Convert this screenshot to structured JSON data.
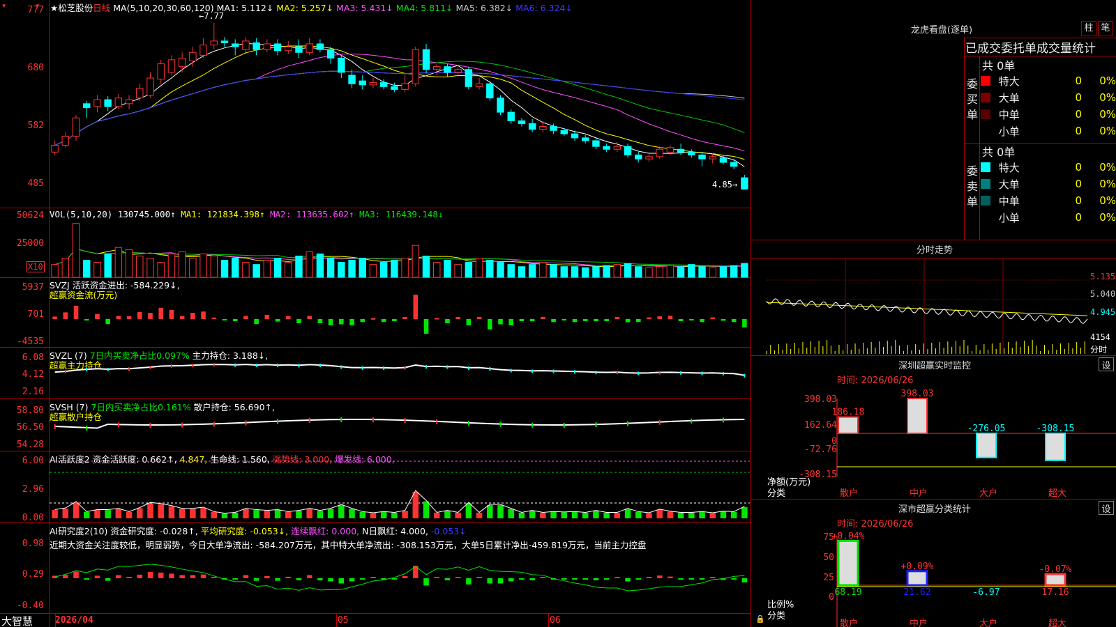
{
  "stock": {
    "name": "松芝股份",
    "period": "日线"
  },
  "main": {
    "ma_label": "MA(5,10,20,30,60,120)",
    "ma1": "MA1: 5.112↓",
    "ma2": "MA2: 5.257↓",
    "ma3": "MA3: 5.431↓",
    "ma4": "MA4: 5.811↓",
    "ma5": "MA5: 6.382↓",
    "ma6": "MA6: 6.324↓",
    "high_marker": "7.77",
    "low_marker": "4.85",
    "y_ticks": [
      "777",
      "680",
      "582",
      "485"
    ]
  },
  "vol": {
    "label": "VOL(5,10,20)",
    "value": "130745.000↑",
    "ma1": "MA1: 121834.398↑",
    "ma2": "MA2: 113635.602↑",
    "ma3": "MA3: 116439.148↓",
    "y_ticks": [
      "50624",
      "25000"
    ],
    "unit": "X10"
  },
  "svzj": {
    "label": "SVZJ",
    "desc": "活跃资金进出: -584.229↓,",
    "sub": "超赢资金流(万元)",
    "y_ticks": [
      "5937",
      "701",
      "-4535"
    ]
  },
  "svzl": {
    "label": "SVZL (7)",
    "desc": "7日内买卖净占比0.097%",
    "hold": "主力持仓: 3.188↓,",
    "sub": "超赢主力持仓",
    "y_ticks": [
      "6.08",
      "4.12",
      "2.16"
    ]
  },
  "svsh": {
    "label": "SVSH (7)",
    "desc": "7日内买卖净占比0.161%",
    "hold": "散户持仓: 56.690↑,",
    "sub": "超赢散户持仓",
    "y_ticks": [
      "58.80",
      "56.50",
      "54.28"
    ]
  },
  "ai1": {
    "label": "AI活跃度2",
    "a": "资金活跃度: 0.662↑,",
    "b": "4.847,",
    "c": "生命线: 1.560,",
    "d": "强势线: 3.000,",
    "e": "爆发线: 6.000,",
    "y_ticks": [
      "6.00",
      "2.96",
      "0.00"
    ]
  },
  "ai2": {
    "label": "AI研究度2(10)",
    "a": "资金研究度: -0.028↑,",
    "b": "平均研究度: -0.053↓,",
    "c": "连续飘红: 0.000,",
    "d": "N日飘红: 4.000,",
    "e": "-0.053↓",
    "note": "近期大资金关注度较低，明显弱势，今日大单净流出: -584.207万元，其中特大单净流出: -308.153万元，大单5日累计净出-459.819万元，当前主力控盘",
    "y_ticks": [
      "0.98",
      "0.29",
      "-0.40"
    ]
  },
  "xaxis": {
    "dates": [
      "2026/04",
      "05",
      "06"
    ],
    "brand": "大智慧"
  },
  "right": {
    "dragon_title": "龙虎看盘(逐单)",
    "tab1": "柱",
    "tab2": "笔",
    "stats_title": "已成交委托单成交量统计",
    "buy": {
      "head": "共 0单",
      "side": "委买单",
      "rows": [
        {
          "name": "特大",
          "count": "0",
          "pct": "0%"
        },
        {
          "name": "大单",
          "count": "0",
          "pct": "0%"
        },
        {
          "name": "中单",
          "count": "0",
          "pct": "0%"
        },
        {
          "name": "小单",
          "count": "0",
          "pct": "0%"
        }
      ]
    },
    "sell": {
      "head": "共 0单",
      "side": "委卖单",
      "rows": [
        {
          "name": "特大",
          "count": "0",
          "pct": "0%"
        },
        {
          "name": "大单",
          "count": "0",
          "pct": "0%"
        },
        {
          "name": "中单",
          "count": "0",
          "pct": "0%"
        },
        {
          "name": "小单",
          "count": "0",
          "pct": "0%"
        }
      ]
    },
    "intraday_title": "分时走势",
    "intraday_y": [
      "5.135",
      "5.040",
      "4.945"
    ],
    "intraday_vol": "4154",
    "intraday_unit": "分时",
    "sz_title": "深圳超赢实时监控",
    "sz_set": "设",
    "sz_time": "时间: 2026/06/26",
    "sz_y": [
      "398.03",
      "162.64",
      "0",
      "-72.76",
      "-308.15"
    ],
    "sz_yunit": "净额(万元)",
    "sz_xunit": "分类",
    "sz_vals": [
      "186.18",
      "398.03",
      "-276.05",
      "-308.15"
    ],
    "cats": [
      "散户",
      "中户",
      "大户",
      "超大"
    ],
    "cls_title": "深市超赢分类统计",
    "cls_set": "设",
    "cls_time": "时间: 2026/06/26",
    "cls_y": [
      "75",
      "50",
      "25",
      "0"
    ],
    "cls_yunit": "比例%",
    "cls_xunit": "分类",
    "cls_top": [
      "+0.04%",
      "+0.09%",
      "",
      "-0.07%"
    ],
    "cls_vals": [
      "68.19",
      "21.62",
      "-6.97",
      "17.16"
    ]
  },
  "chart_data": {
    "type": "candlestick",
    "title": "松芝股份 日线",
    "ylim": [
      4.85,
      7.77
    ],
    "candles": [
      {
        "o": 5.5,
        "c": 5.62,
        "h": 5.7,
        "l": 5.45
      },
      {
        "o": 5.62,
        "c": 5.78,
        "h": 5.85,
        "l": 5.58
      },
      {
        "o": 5.78,
        "c": 6.1,
        "h": 6.15,
        "l": 5.7
      },
      {
        "o": 6.35,
        "c": 6.28,
        "h": 6.4,
        "l": 6.1
      },
      {
        "o": 6.3,
        "c": 6.42,
        "h": 6.5,
        "l": 6.2
      },
      {
        "o": 6.42,
        "c": 6.3,
        "h": 6.48,
        "l": 6.22
      },
      {
        "o": 6.3,
        "c": 6.45,
        "h": 6.52,
        "l": 6.25
      },
      {
        "o": 6.35,
        "c": 6.42,
        "h": 6.5,
        "l": 6.25
      },
      {
        "o": 6.45,
        "c": 6.62,
        "h": 6.7,
        "l": 6.4
      },
      {
        "o": 6.5,
        "c": 6.8,
        "h": 6.9,
        "l": 6.45
      },
      {
        "o": 6.78,
        "c": 7.05,
        "h": 7.12,
        "l": 6.7
      },
      {
        "o": 6.9,
        "c": 7.12,
        "h": 7.2,
        "l": 6.85
      },
      {
        "o": 7.0,
        "c": 7.15,
        "h": 7.25,
        "l": 6.9
      },
      {
        "o": 7.1,
        "c": 7.25,
        "h": 7.35,
        "l": 7.0
      },
      {
        "o": 7.2,
        "c": 7.38,
        "h": 7.5,
        "l": 7.15
      },
      {
        "o": 7.38,
        "c": 7.45,
        "h": 7.77,
        "l": 7.3
      },
      {
        "o": 7.45,
        "c": 7.42,
        "h": 7.52,
        "l": 7.35
      },
      {
        "o": 7.4,
        "c": 7.35,
        "h": 7.48,
        "l": 7.2
      },
      {
        "o": 7.3,
        "c": 7.45,
        "h": 7.52,
        "l": 7.25
      },
      {
        "o": 7.42,
        "c": 7.3,
        "h": 7.5,
        "l": 7.2
      },
      {
        "o": 7.3,
        "c": 7.4,
        "h": 7.48,
        "l": 7.25
      },
      {
        "o": 7.4,
        "c": 7.28,
        "h": 7.48,
        "l": 7.2
      },
      {
        "o": 7.28,
        "c": 7.35,
        "h": 7.45,
        "l": 7.22
      },
      {
        "o": 7.35,
        "c": 7.25,
        "h": 7.48,
        "l": 7.15
      },
      {
        "o": 7.25,
        "c": 7.4,
        "h": 7.5,
        "l": 7.2
      },
      {
        "o": 7.4,
        "c": 7.3,
        "h": 7.48,
        "l": 7.25
      },
      {
        "o": 7.3,
        "c": 7.15,
        "h": 7.35,
        "l": 7.05
      },
      {
        "o": 7.15,
        "c": 6.9,
        "h": 7.2,
        "l": 6.8
      },
      {
        "o": 6.85,
        "c": 6.7,
        "h": 6.95,
        "l": 6.62
      },
      {
        "o": 6.75,
        "c": 6.68,
        "h": 6.85,
        "l": 6.6
      },
      {
        "o": 6.68,
        "c": 6.72,
        "h": 6.8,
        "l": 6.62
      },
      {
        "o": 6.72,
        "c": 6.65,
        "h": 6.78,
        "l": 6.6
      },
      {
        "o": 6.65,
        "c": 6.6,
        "h": 6.72,
        "l": 6.55
      },
      {
        "o": 6.6,
        "c": 6.7,
        "h": 6.85,
        "l": 6.55
      },
      {
        "o": 6.7,
        "c": 7.3,
        "h": 7.35,
        "l": 6.65
      },
      {
        "o": 7.3,
        "c": 6.95,
        "h": 7.4,
        "l": 6.88
      },
      {
        "o": 6.95,
        "c": 7.0,
        "h": 7.05,
        "l": 6.85
      },
      {
        "o": 7.0,
        "c": 6.9,
        "h": 7.05,
        "l": 6.82
      },
      {
        "o": 6.9,
        "c": 6.95,
        "h": 7.0,
        "l": 6.82
      },
      {
        "o": 6.95,
        "c": 6.65,
        "h": 7.0,
        "l": 6.6
      },
      {
        "o": 6.65,
        "c": 6.7,
        "h": 6.8,
        "l": 6.6
      },
      {
        "o": 6.7,
        "c": 6.45,
        "h": 6.75,
        "l": 6.4
      },
      {
        "o": 6.45,
        "c": 6.2,
        "h": 6.5,
        "l": 6.15
      },
      {
        "o": 6.2,
        "c": 6.05,
        "h": 6.25,
        "l": 6.0
      },
      {
        "o": 6.05,
        "c": 6.0,
        "h": 6.1,
        "l": 5.95
      },
      {
        "o": 6.0,
        "c": 5.9,
        "h": 6.08,
        "l": 5.85
      },
      {
        "o": 5.9,
        "c": 5.95,
        "h": 6.05,
        "l": 5.85
      },
      {
        "o": 5.95,
        "c": 5.88,
        "h": 6.0,
        "l": 5.82
      },
      {
        "o": 5.88,
        "c": 5.82,
        "h": 5.92,
        "l": 5.78
      },
      {
        "o": 5.82,
        "c": 5.75,
        "h": 5.88,
        "l": 5.7
      },
      {
        "o": 5.75,
        "c": 5.7,
        "h": 5.8,
        "l": 5.65
      },
      {
        "o": 5.7,
        "c": 5.6,
        "h": 5.75,
        "l": 5.55
      },
      {
        "o": 5.6,
        "c": 5.55,
        "h": 5.65,
        "l": 5.5
      },
      {
        "o": 5.55,
        "c": 5.6,
        "h": 5.68,
        "l": 5.5
      },
      {
        "o": 5.6,
        "c": 5.45,
        "h": 5.65,
        "l": 5.4
      },
      {
        "o": 5.45,
        "c": 5.38,
        "h": 5.5,
        "l": 5.32
      },
      {
        "o": 5.38,
        "c": 5.42,
        "h": 5.48,
        "l": 5.32
      },
      {
        "o": 5.42,
        "c": 5.55,
        "h": 5.6,
        "l": 5.38
      },
      {
        "o": 5.5,
        "c": 5.58,
        "h": 5.62,
        "l": 5.45
      },
      {
        "o": 5.55,
        "c": 5.5,
        "h": 5.65,
        "l": 5.45
      },
      {
        "o": 5.5,
        "c": 5.45,
        "h": 5.55,
        "l": 5.4
      },
      {
        "o": 5.45,
        "c": 5.38,
        "h": 5.5,
        "l": 5.25
      },
      {
        "o": 5.38,
        "c": 5.42,
        "h": 5.48,
        "l": 5.3
      },
      {
        "o": 5.4,
        "c": 5.32,
        "h": 5.45,
        "l": 5.28
      },
      {
        "o": 5.32,
        "c": 5.25,
        "h": 5.38,
        "l": 5.2
      },
      {
        "o": 5.05,
        "c": 4.85,
        "h": 5.1,
        "l": 4.85
      }
    ],
    "volume": [
      12,
      18,
      50.6,
      16,
      14,
      22,
      28,
      26,
      20,
      18,
      14,
      22,
      24,
      18,
      22,
      20,
      16,
      18,
      14,
      12,
      16,
      18,
      14,
      20,
      24,
      22,
      18,
      14,
      16,
      18,
      12,
      14,
      16,
      18,
      30,
      20,
      14,
      16,
      12,
      14,
      18,
      16,
      14,
      12,
      10,
      12,
      14,
      12,
      10,
      10,
      9,
      10,
      11,
      12,
      13,
      10,
      9,
      10,
      11,
      10,
      12,
      10,
      9,
      10,
      11,
      13.07
    ]
  }
}
